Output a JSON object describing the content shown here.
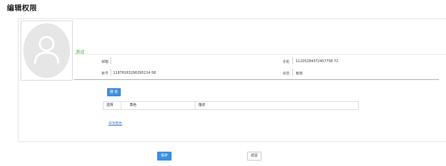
{
  "page": {
    "title": "编辑权限"
  },
  "user": {
    "name": "测试",
    "email_label": "邮箱",
    "email_value": "",
    "phone_label": "手机",
    "phone_value": "11205284372457758 72",
    "account_label": "账号",
    "account_value": "11876163290295214 08",
    "status_label": "状态",
    "status_value": "有效"
  },
  "actions": {
    "delete_label": "删 除",
    "add_role_label": "添加角色",
    "save_label": "保存",
    "back_label": "返回"
  },
  "role_table": {
    "headers": [
      "选择",
      "角色",
      "描述"
    ]
  },
  "colors": {
    "primary": "#3d8fe0",
    "accent_green": "#4caf50"
  }
}
